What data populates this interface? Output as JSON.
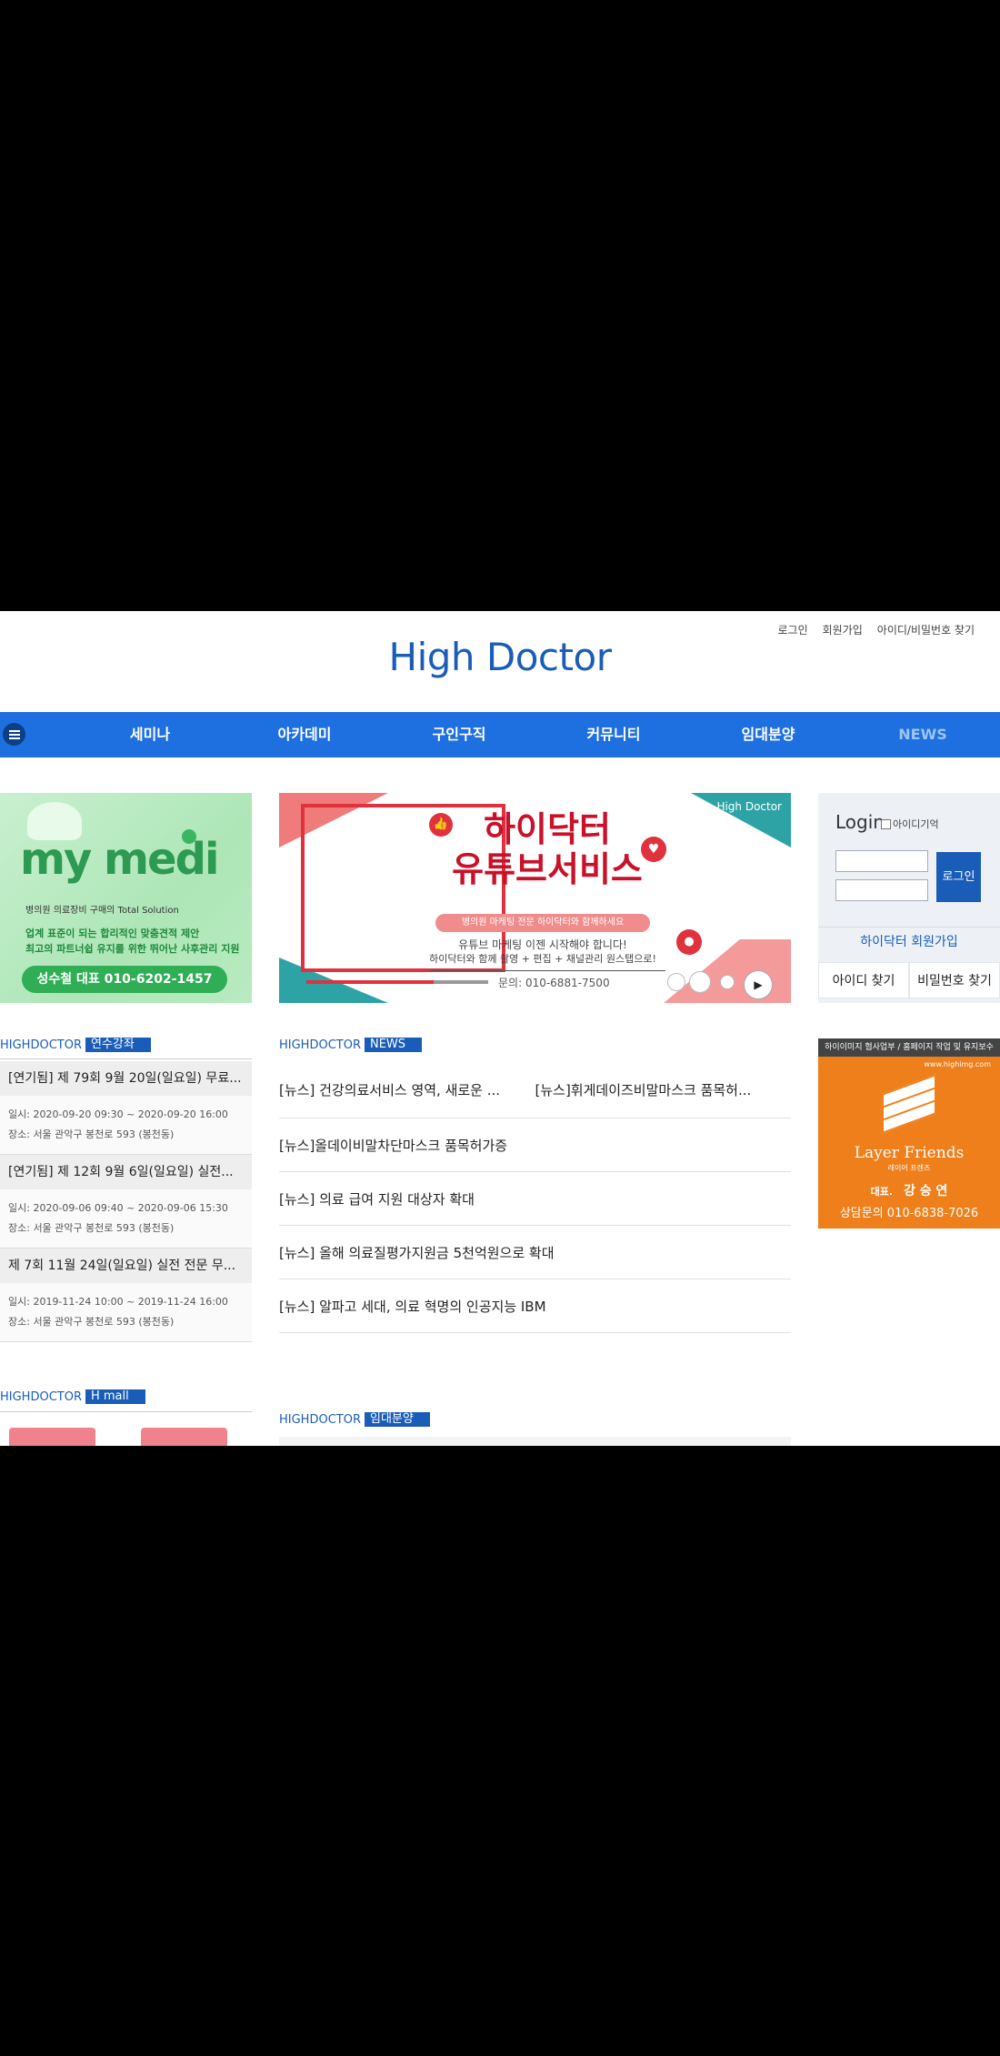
{
  "header": {
    "util_links": [
      "로그인",
      "회원가입",
      "아이디/비밀번호 찾기"
    ],
    "logo": "High Doctor"
  },
  "nav": {
    "items": [
      "세미나",
      "아카데미",
      "구인구직",
      "커뮤니티",
      "임대분양",
      "NEWS"
    ]
  },
  "left_ad": {
    "brand": "my medi",
    "tagline": "병의원 의료장비 구매의 Total Solution",
    "line1": "업계 표준이 되는 합리적인 맞춤견적 제안",
    "line2": "최고의 파트너쉽 유지를 위한 뛰어난 사후관리 지원",
    "cta": "성수철 대표 010-6202-1457"
  },
  "slider": {
    "brand": "High Doctor",
    "headline1": "하이닥터",
    "headline2": "유튜브서비스",
    "pill": "병의원 마케팅 전문 하이닥터와 함께하세요",
    "sub1": "유튜브 마케팅 이젠 시작해야 합니다!",
    "sub2": "하이닥터와 함께 촬영 + 편집 + 채널관리 원스탭으로!",
    "phone": "문의: 010-6881-7500"
  },
  "login": {
    "title": "Login",
    "remember": "아이디기억",
    "button": "로그인",
    "join": "하이닥터 회원가입",
    "find_id": "아이디 찾기",
    "find_pw": "비밀번호 찾기"
  },
  "sections": {
    "edu": {
      "prefix": "HIGHDOCTOR",
      "tag": "연수강좌"
    },
    "news": {
      "prefix": "HIGHDOCTOR",
      "tag": "NEWS"
    },
    "hmall": {
      "prefix": "HIGHDOCTOR",
      "tag": "H mall"
    },
    "rent": {
      "prefix": "HIGHDOCTOR",
      "tag": "임대분양"
    }
  },
  "edu_items": [
    {
      "title": "[연기됨] 제 79회 9월 20일(일요일) 무료...",
      "date": "일시: 2020-09-20 09:30 ~ 2020-09-20 16:00",
      "place": "장소: 서울 관악구 봉천로 593 (봉천동)"
    },
    {
      "title": "[연기됨] 제 12회 9월 6일(일요일) 실전...",
      "date": "일시: 2020-09-06 09:40 ~ 2020-09-06 15:30",
      "place": "장소: 서울 관악구 봉천로 593 (봉천동)"
    },
    {
      "title": "제 7회 11월 24일(일요일) 실전 전문 무...",
      "date": "일시: 2019-11-24 10:00 ~ 2019-11-24 16:00",
      "place": "장소: 서울 관악구 봉천로 593 (봉천동)"
    }
  ],
  "news_items": [
    [
      "[뉴스] 건강의료서비스 영역, 새로운 ...",
      "[뉴스]휘게데이즈비말마스크 품목허..."
    ],
    [
      "[뉴스]올데이비말차단마스크 품목허가증"
    ],
    [
      "[뉴스] 의료 급여 지원 대상자 확대"
    ],
    [
      "[뉴스] 올해 의료질평가지원금 5천억원으로 확대"
    ],
    [
      "[뉴스] 알파고 세대, 의료 혁명의 인공지능 IBM"
    ]
  ],
  "right_ad": {
    "top": "하이이미지 협사업부 / 홈페이지 작업 및 유지보수",
    "url": "www.highimg.com",
    "name": "Layer Friends",
    "kname": "레이어 프렌즈",
    "ceo_label": "대표.",
    "ceo": "강 승 연",
    "call": "상담문의 010-6838-7026"
  },
  "colors": {
    "brand_blue": "#1a5db8",
    "nav_blue": "#1e6fe0",
    "orange": "#ef7f1a",
    "green": "#2fae56",
    "red": "#e0323c"
  }
}
